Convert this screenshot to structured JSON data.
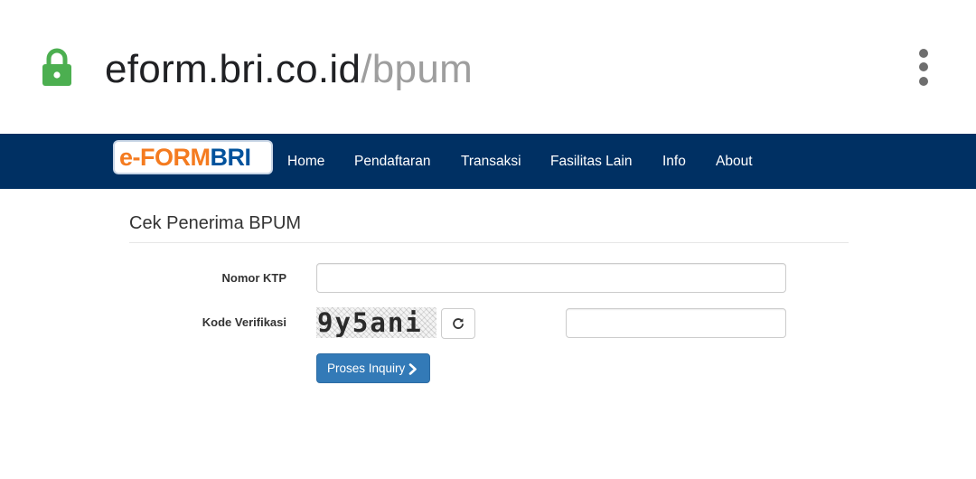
{
  "browser": {
    "url_host": "eform.bri.co.id",
    "url_path": "/bpum",
    "lock_icon": "lock-icon",
    "menu_icon": "more-vert-icon",
    "lock_color": "#4caf50"
  },
  "navbar": {
    "logo": {
      "part1": "e-",
      "part2": "FORM",
      "part3": "BRI"
    },
    "items": [
      "Home",
      "Pendaftaran",
      "Transaksi",
      "Fasilitas Lain",
      "Info",
      "About"
    ],
    "background": "#003063"
  },
  "page": {
    "title": "Cek Penerima BPUM"
  },
  "form": {
    "ktp_label": "Nomor KTP",
    "ktp_value": "",
    "kode_label": "Kode Verifikasi",
    "captcha_text": "9y5ani",
    "kode_value": "",
    "refresh_icon": "refresh-icon",
    "submit_label": "Proses Inquiry",
    "submit_icon": "chevron-right-icon",
    "submit_color": "#337ab7"
  }
}
